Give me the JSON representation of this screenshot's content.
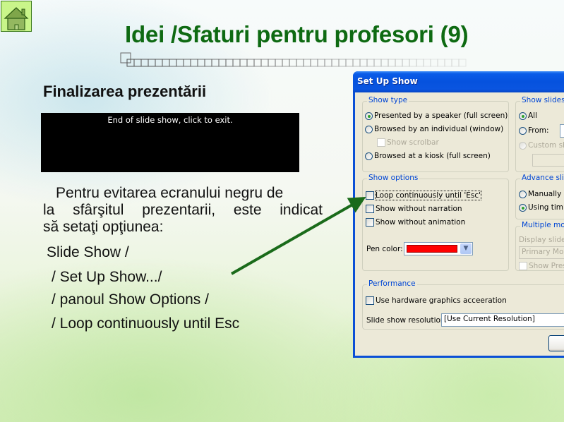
{
  "slide": {
    "title": "Idei /Sfaturi pentru profesori (9)",
    "subtitle": "Finalizarea prezentării",
    "home_icon": "home-icon",
    "end_screen_text": "End of slide show, click to exit.",
    "body_lines": [
      [
        "Pentru evitarea ecranului negru de"
      ],
      [
        "la",
        "sfârşitul",
        "prezentarii,",
        "este",
        "indicat"
      ],
      [
        "să setaţi opţiunea:"
      ]
    ],
    "steps": [
      " Slide Show /",
      "/ Set Up Show.../",
      "/ panoul Show Options /",
      "/ Loop continuously until Esc"
    ],
    "colors": {
      "title": "#0e6a12",
      "arrow": "#1a6b1a",
      "pen_color": "#ff0000"
    }
  },
  "dialog": {
    "title": "Set Up Show",
    "show_type": {
      "legend": "Show type",
      "options": [
        {
          "label": "Presented by a speaker (full screen)",
          "selected": true
        },
        {
          "label": "Browsed by an individual (window)",
          "selected": false
        },
        {
          "label": "Browsed at a kiosk (full screen)",
          "selected": false
        }
      ],
      "show_scrollbar": {
        "label": "Show scrolbar",
        "checked": false,
        "disabled": true
      }
    },
    "show_slides": {
      "legend": "Show slides",
      "all": {
        "label": "All",
        "selected": true
      },
      "from": {
        "label": "From:",
        "selected": false,
        "value": ""
      },
      "custom": {
        "label": "Custom sh",
        "selected": false,
        "disabled": true
      }
    },
    "show_options": {
      "legend": "Show options",
      "options": [
        {
          "label": "Loop continuously until 'Esc'",
          "checked": false
        },
        {
          "label": "Show without narration",
          "checked": false
        },
        {
          "label": "Show without animation",
          "checked": false
        }
      ],
      "pen_color_label": "Pen color:"
    },
    "advance_slides": {
      "legend": "Advance slide",
      "manually": {
        "label": "Manually",
        "selected": false
      },
      "timings": {
        "label": "Using timin",
        "selected": true
      }
    },
    "multiple_monitors": {
      "legend": "Multiple monit",
      "display_label": "Display slide s",
      "monitor_value": "Primary Moni",
      "presenter": {
        "label": "Show Pres",
        "checked": false,
        "disabled": true
      }
    },
    "performance": {
      "legend": "Performance",
      "hw_accel": {
        "label": "Use hardware graphics acceeration",
        "checked": false
      },
      "resolution_label": "Slide show resolution:",
      "resolution_value": "[Use Current Resolution]"
    }
  }
}
